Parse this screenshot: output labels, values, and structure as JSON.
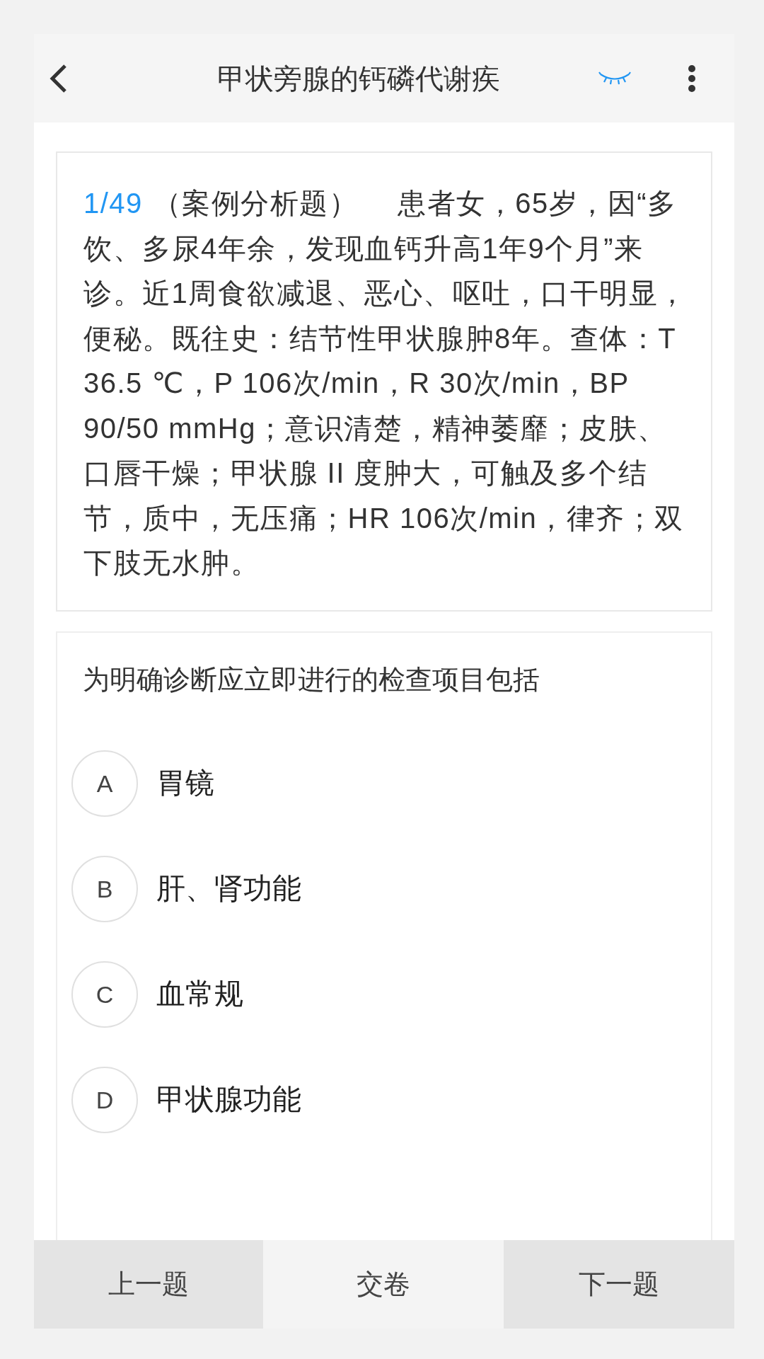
{
  "header": {
    "title": "甲状旁腺的钙磷代谢疾"
  },
  "case": {
    "index": "1/49",
    "type": "（案例分析题）",
    "text": "患者女，65岁，因“多饮、多尿4年余，发现血钙升高1年9个月”来诊。近1周食欲减退、恶心、呕吐，口干明显，便秘。既往史：结节性甲状腺肿8年。查体：T 36.5 ℃，P 106次/min，R 30次/min，BP 90/50 mmHg；意识清楚，精神萎靡；皮肤、口唇干燥；甲状腺 II 度肿大，可触及多个结节，质中，无压痛；HR 106次/min，律齐；双下肢无水肿。"
  },
  "question": {
    "text": "为明确诊断应立即进行的检查项目包括",
    "options": [
      {
        "letter": "A",
        "text": "胃镜",
        "selected": false
      },
      {
        "letter": "B",
        "text": "肝、肾功能",
        "selected": false
      },
      {
        "letter": "C",
        "text": "血常规",
        "selected": false
      },
      {
        "letter": "D",
        "text": "甲状腺功能",
        "selected": false
      }
    ]
  },
  "footer": {
    "buttons": [
      {
        "label": "上一题",
        "kind": "nav"
      },
      {
        "label": "交卷",
        "kind": "submit"
      },
      {
        "label": "下一题",
        "kind": "nav"
      }
    ]
  }
}
